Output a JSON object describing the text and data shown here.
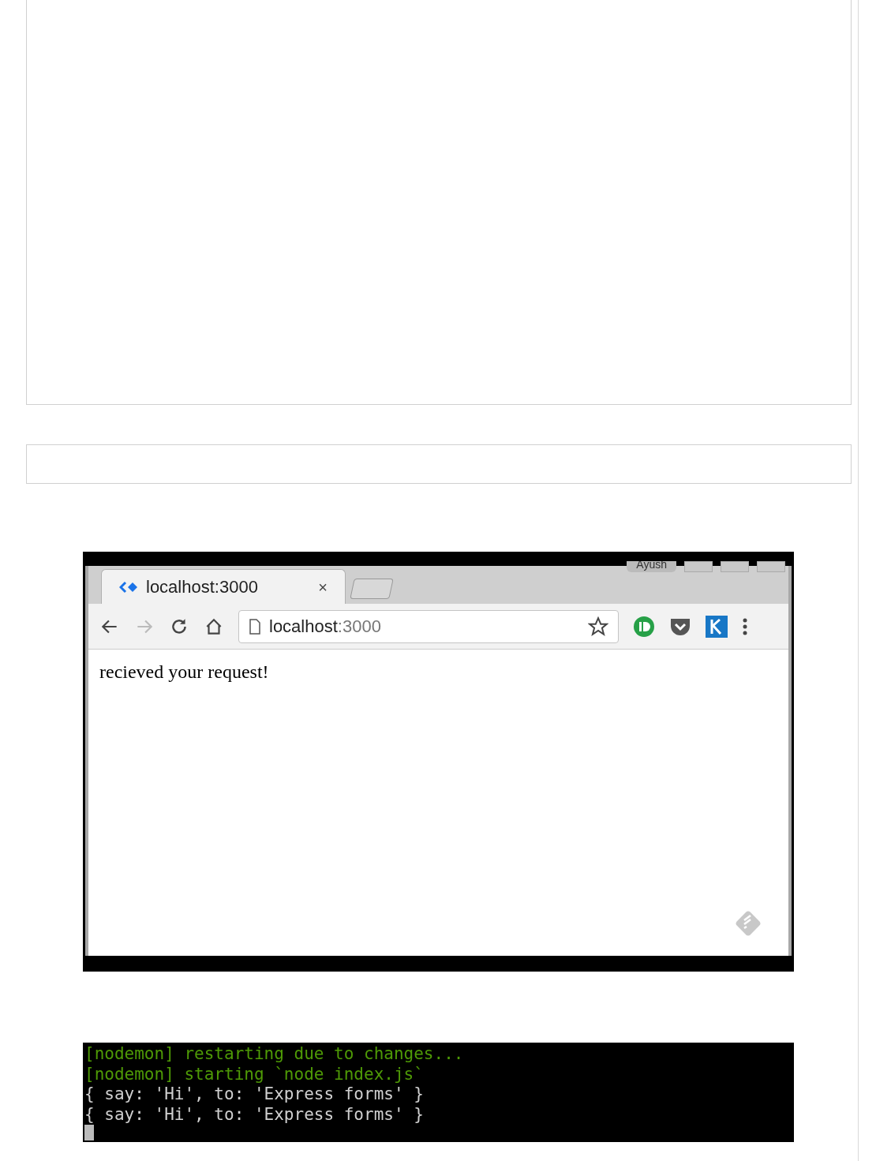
{
  "browser": {
    "profile": "Ayush",
    "tab": {
      "title": "localhost:3000",
      "close": "×"
    },
    "address": {
      "host": "localhost",
      "port": ":3000"
    },
    "body_text": "recieved your request!"
  },
  "terminal": {
    "lines": [
      {
        "kind": "nodemon",
        "text": "[nodemon] restarting due to changes..."
      },
      {
        "kind": "nodemon",
        "text": "[nodemon] starting `node index.js`"
      },
      {
        "kind": "log",
        "text": "{ say: 'Hi', to: 'Express forms' }"
      },
      {
        "kind": "log",
        "text": "{ say: 'Hi', to: 'Express forms' }"
      }
    ],
    "cursor": true
  }
}
